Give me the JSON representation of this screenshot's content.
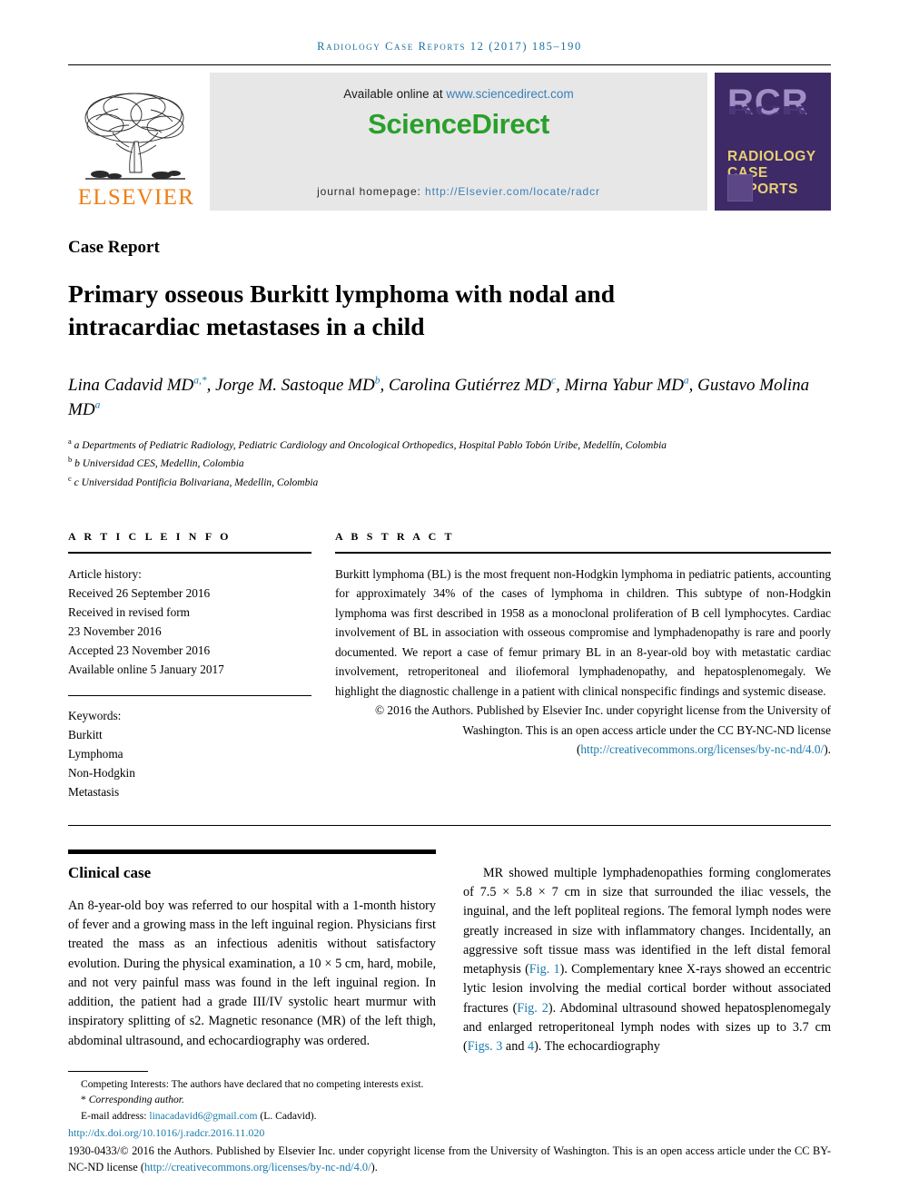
{
  "running_head": "Radiology Case Reports 12 (2017) 185–190",
  "masthead": {
    "elsevier_word": "ELSEVIER",
    "available_prefix": "Available online at ",
    "available_link": "www.sciencedirect.com",
    "sciencedirect_logo": "ScienceDirect",
    "homepage_label": "journal homepage: ",
    "homepage_link": "http://Elsevier.com/locate/radcr",
    "rcr_letters": "RCR",
    "rcr_title_line1": "RADIOLOGY",
    "rcr_title_line2": "CASE",
    "rcr_title_line3": "REPORTS"
  },
  "article": {
    "type_label": "Case Report",
    "title": "Primary osseous Burkitt lymphoma with nodal and intracardiac metastases in a child",
    "authors_html": "Lina Cadavid MD<sup>a,*</sup>, Jorge M. Sastoque MD<sup>b</sup>, Carolina Gutiérrez MD<sup>c</sup>, Mirna Yabur MD<sup>a</sup>, Gustavo Molina MD<sup>a</sup>",
    "affiliations": [
      "a Departments of Pediatric Radiology, Pediatric Cardiology and Oncological Orthopedics, Hospital Pablo Tobón Uribe, Medellín, Colombia",
      "b Universidad CES, Medellin, Colombia",
      "c Universidad Pontificia Bolivariana, Medellin, Colombia"
    ]
  },
  "article_info": {
    "heading": "A R T I C L E  I N F O",
    "history_label": "Article history:",
    "received": "Received 26 September 2016",
    "revised_label": "Received in revised form",
    "revised_date": "23 November 2016",
    "accepted": "Accepted 23 November 2016",
    "available_online": "Available online 5 January 2017",
    "keywords_label": "Keywords:",
    "keywords": [
      "Burkitt",
      "Lymphoma",
      "Non-Hodgkin",
      "Metastasis"
    ]
  },
  "abstract": {
    "heading": "A B S T R A C T",
    "text": "Burkitt lymphoma (BL) is the most frequent non-Hodgkin lymphoma in pediatric patients, accounting for approximately 34% of the cases of lymphoma in children. This subtype of non-Hodgkin lymphoma was first described in 1958 as a monoclonal proliferation of B cell lymphocytes. Cardiac involvement of BL in association with osseous compromise and lymphadenopathy is rare and poorly documented. We report a case of femur primary BL in an 8-year-old boy with metastatic cardiac involvement, retroperitoneal and iliofemoral lymphadenopathy, and hepatosplenomegaly. We highlight the diagnostic challenge in a patient with clinical nonspecific findings and systemic disease.",
    "copyright_text": "© 2016 the Authors. Published by Elsevier Inc. under copyright license from the University of Washington. This is an open access article under the CC BY-NC-ND license (",
    "copyright_link": "http://creativecommons.org/licenses/by-nc-nd/4.0/",
    "copyright_tail": ")."
  },
  "body": {
    "left_heading": "Clinical case",
    "left_paragraph": "An 8-year-old boy was referred to our hospital with a 1-month history of fever and a growing mass in the left inguinal region. Physicians first treated the mass as an infectious adenitis without satisfactory evolution. During the physical examination, a 10 × 5 cm, hard, mobile, and not very painful mass was found in the left inguinal region. In addition, the patient had a grade III/IV systolic heart murmur with inspiratory splitting of s2. Magnetic resonance (MR) of the left thigh, abdominal ultrasound, and echocardiography was ordered.",
    "right_parts": {
      "p1": "MR showed multiple lymphadenopathies forming conglomerates of 7.5 × 5.8 × 7 cm in size that surrounded the iliac vessels, the inguinal, and the left popliteal regions. The femoral lymph nodes were greatly increased in size with inflammatory changes. Incidentally, an aggressive soft tissue mass was identified in the left distal femoral metaphysis (",
      "ref1": "Fig. 1",
      "p2": "). Complementary knee X-rays showed an eccentric lytic lesion involving the medial cortical border without associated fractures (",
      "ref2": "Fig. 2",
      "p3": "). Abdominal ultrasound showed hepatosplenomegaly and enlarged retroperitoneal lymph nodes with sizes up to 3.7 cm (",
      "ref3": "Figs. 3",
      "p4": " and ",
      "ref4": "4",
      "p5": "). The echocardiography"
    }
  },
  "footnotes": {
    "competing": "Competing Interests: The authors have declared that no competing interests exist.",
    "corresponding_marker": "*",
    "corresponding": "Corresponding author.",
    "email_label": "E-mail address: ",
    "email_link": "linacadavid6@gmail.com",
    "email_suffix": " (L. Cadavid).",
    "doi": "http://dx.doi.org/10.1016/j.radcr.2016.11.020",
    "license_prefix": "1930-0433/© 2016 the Authors. Published by Elsevier Inc. under copyright license from the University of Washington. This is an open access article under the CC BY-NC-ND license (",
    "license_link": "http://creativecommons.org/licenses/by-nc-nd/4.0/",
    "license_tail": ")."
  },
  "colors": {
    "link_blue": "#1a7bad",
    "elsevier_orange": "#f07e13",
    "sciencedirect_green": "#2aa02a",
    "rcr_purple": "#3f2a68",
    "rcr_gold": "#e8cf74"
  }
}
